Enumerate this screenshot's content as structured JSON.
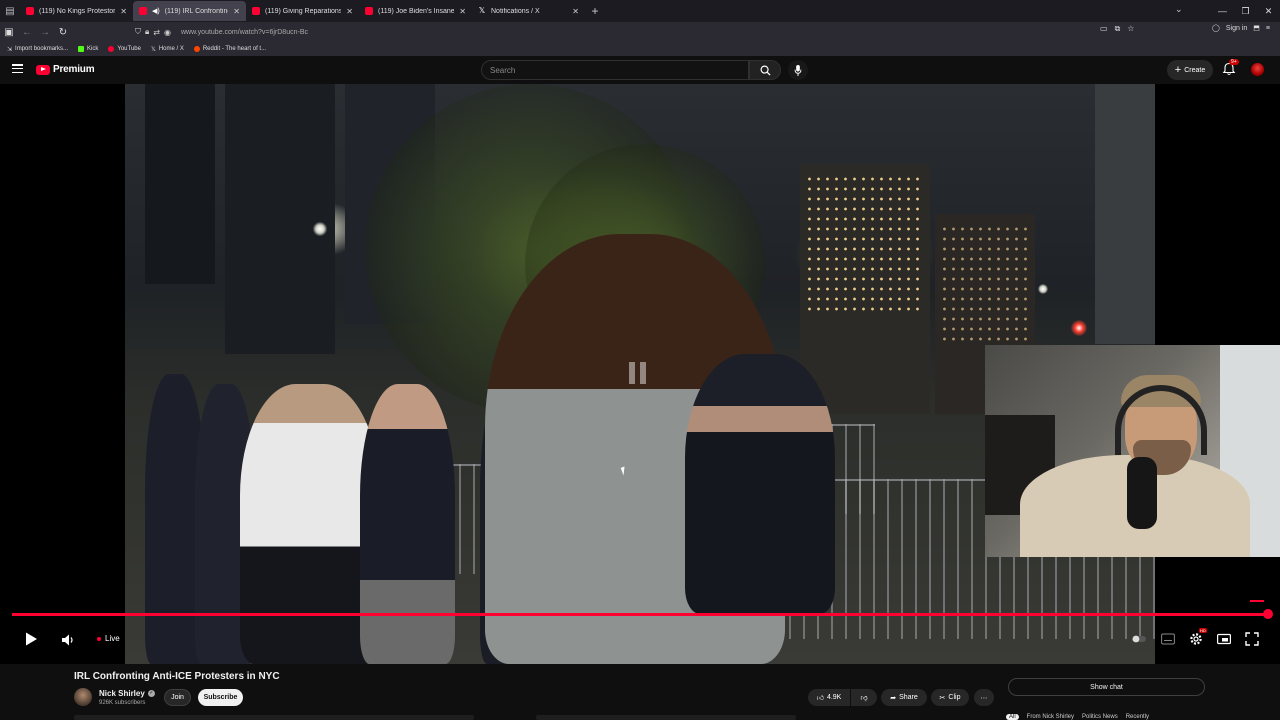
{
  "browser": {
    "tabs": [
      {
        "label": "(119) No Kings Protestors Go C",
        "active": false
      },
      {
        "label": "(119) IRL Confronting Anti-",
        "active": true
      },
      {
        "label": "(119) Giving Reparations at No",
        "active": false
      },
      {
        "label": "(119) Joe Biden's Insane though",
        "active": false
      },
      {
        "label": "Notifications / X",
        "active": false
      }
    ],
    "url": "www.youtube.com/watch?v=6jrD8ucn-Bc",
    "sign_in": "Sign in",
    "bookmarks": [
      "Import bookmarks...",
      "Kick",
      "YouTube",
      "Home / X",
      "Reddit - The heart of t..."
    ]
  },
  "youtube": {
    "brand": "Premium",
    "search_placeholder": "Search",
    "create_label": "Create",
    "notif_badge": "9+"
  },
  "player": {
    "live_label": "Live",
    "hd_badge": "HD"
  },
  "video": {
    "title": "IRL Confronting Anti-ICE Protesters in NYC",
    "channel": "Nick Shirley",
    "subscribers": "926K subscribers",
    "join_label": "Join",
    "subscribe_label": "Subscribe",
    "likes": "4.9K",
    "share_label": "Share",
    "clip_label": "Clip",
    "show_chat_label": "Show chat"
  },
  "chips": [
    "All",
    "From Nick Shirley",
    "Politics News",
    "Recently"
  ],
  "colors": {
    "accent": "#ff0033",
    "background": "#0f0f0f"
  }
}
